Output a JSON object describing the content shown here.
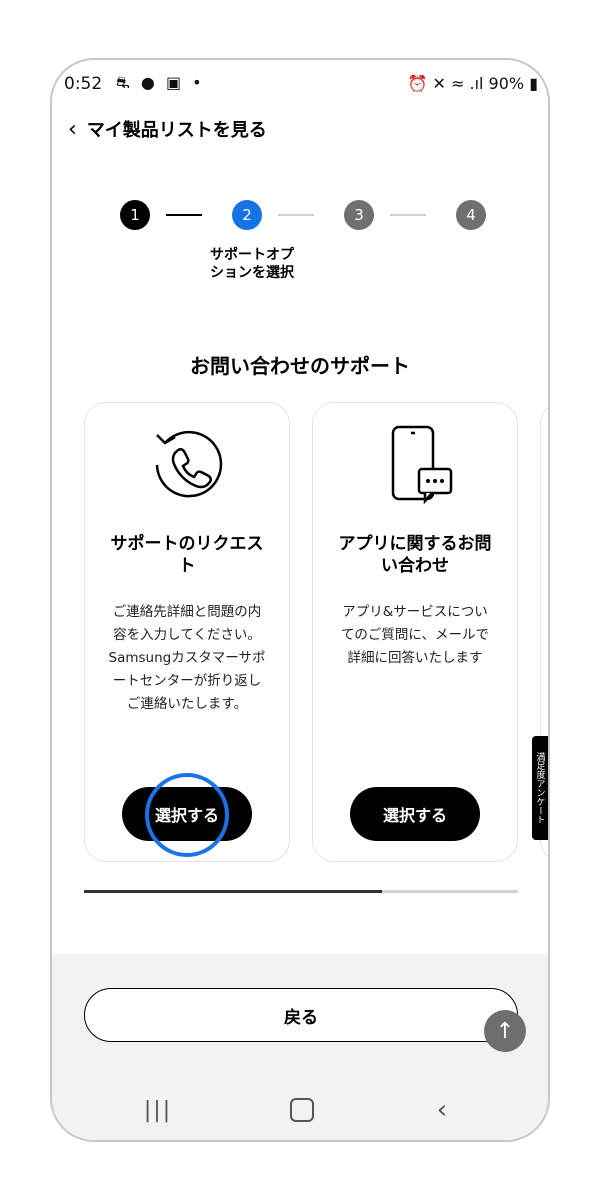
{
  "status_bar": {
    "time": "0:52",
    "left_icons": "⛐ ● ▣ •",
    "right_text": "⏰ ✕ ≈ .ıl 90% ▮"
  },
  "header": {
    "title": "マイ製品リストを見る"
  },
  "stepper": {
    "steps": [
      "1",
      "2",
      "3",
      "4"
    ],
    "current_label": "サポートオプ\nションを選択"
  },
  "section_title": "お問い合わせのサポート",
  "cards": [
    {
      "title": "サポートのリクエス\nト",
      "description": "ご連絡先詳細と問題の内\n容を入力してください。\nSamsungカスタマーサポ\nートセンターが折り返し\nご連絡いたします。",
      "button": "選択する"
    },
    {
      "title": "アプリに関するお問\nい合わせ",
      "description": "アプリ&サービスについ\nてのご質問に、メールで\n詳細に回答いたします",
      "button": "選択する"
    }
  ],
  "survey_tab": "満足度アンケート",
  "back_button": "戻る",
  "colors": {
    "accent": "#1673e6",
    "dark": "#000000",
    "inactive_step": "#707070"
  }
}
